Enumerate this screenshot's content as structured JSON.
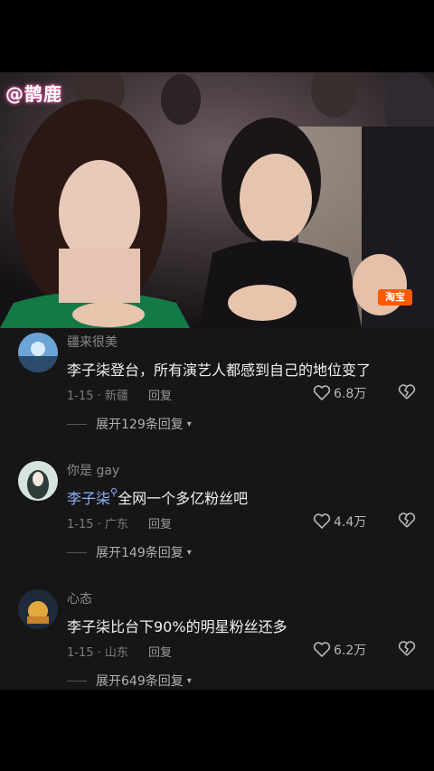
{
  "video": {
    "watermark": "@鹊鹿",
    "badge": "淘宝"
  },
  "comments": [
    {
      "username": "疆来很美",
      "mention": "",
      "text": "李子柒登台，所有演艺人都感到自己的地位变了",
      "date": "1-15 · 新疆",
      "reply_label": "回复",
      "likes": "6.8万",
      "expand": "展开129条回复"
    },
    {
      "username": "你是 gay",
      "mention": "李子柒",
      "text": "全网一个多亿粉丝吧",
      "date": "1-15 · 广东",
      "reply_label": "回复",
      "likes": "4.4万",
      "expand": "展开149条回复"
    },
    {
      "username": "心态",
      "mention": "",
      "text": "李子柒比台下90%的明星粉丝还多",
      "date": "1-15 · 山东",
      "reply_label": "回复",
      "likes": "6.2万",
      "expand": "展开649条回复"
    }
  ]
}
